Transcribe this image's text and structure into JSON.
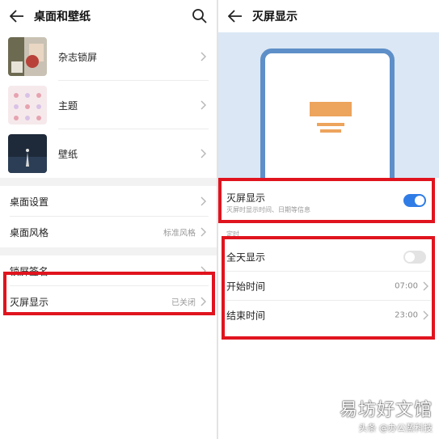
{
  "left": {
    "title": "桌面和壁纸",
    "wallpaper_items": [
      {
        "label": "杂志锁屏"
      },
      {
        "label": "主题"
      },
      {
        "label": "壁纸"
      }
    ],
    "desktop_items": [
      {
        "label": "桌面设置",
        "value": ""
      },
      {
        "label": "桌面风格",
        "value": "标准风格"
      }
    ],
    "lock_items": [
      {
        "label": "锁屏签名",
        "value": ""
      },
      {
        "label": "灭屏显示",
        "value": "已关闭"
      }
    ]
  },
  "right": {
    "title": "灭屏显示",
    "aod": {
      "label": "灭屏显示",
      "subtitle": "灭屏时显示时间、日期等信息",
      "enabled": true
    },
    "schedule_section_label": "定时",
    "all_day": {
      "label": "全天显示",
      "enabled": false
    },
    "start_time": {
      "label": "开始时间",
      "value": "07:00"
    },
    "end_time": {
      "label": "结束时间",
      "value": "23:00"
    }
  },
  "watermark": {
    "main": "易坊好文馆",
    "sub": "头条 @办公蒸科技"
  },
  "colors": {
    "accent_blue": "#2f7ce6",
    "highlight_red": "#e0141e",
    "preview_bg": "#dbe7f4",
    "clock_orange": "#eda45d"
  }
}
